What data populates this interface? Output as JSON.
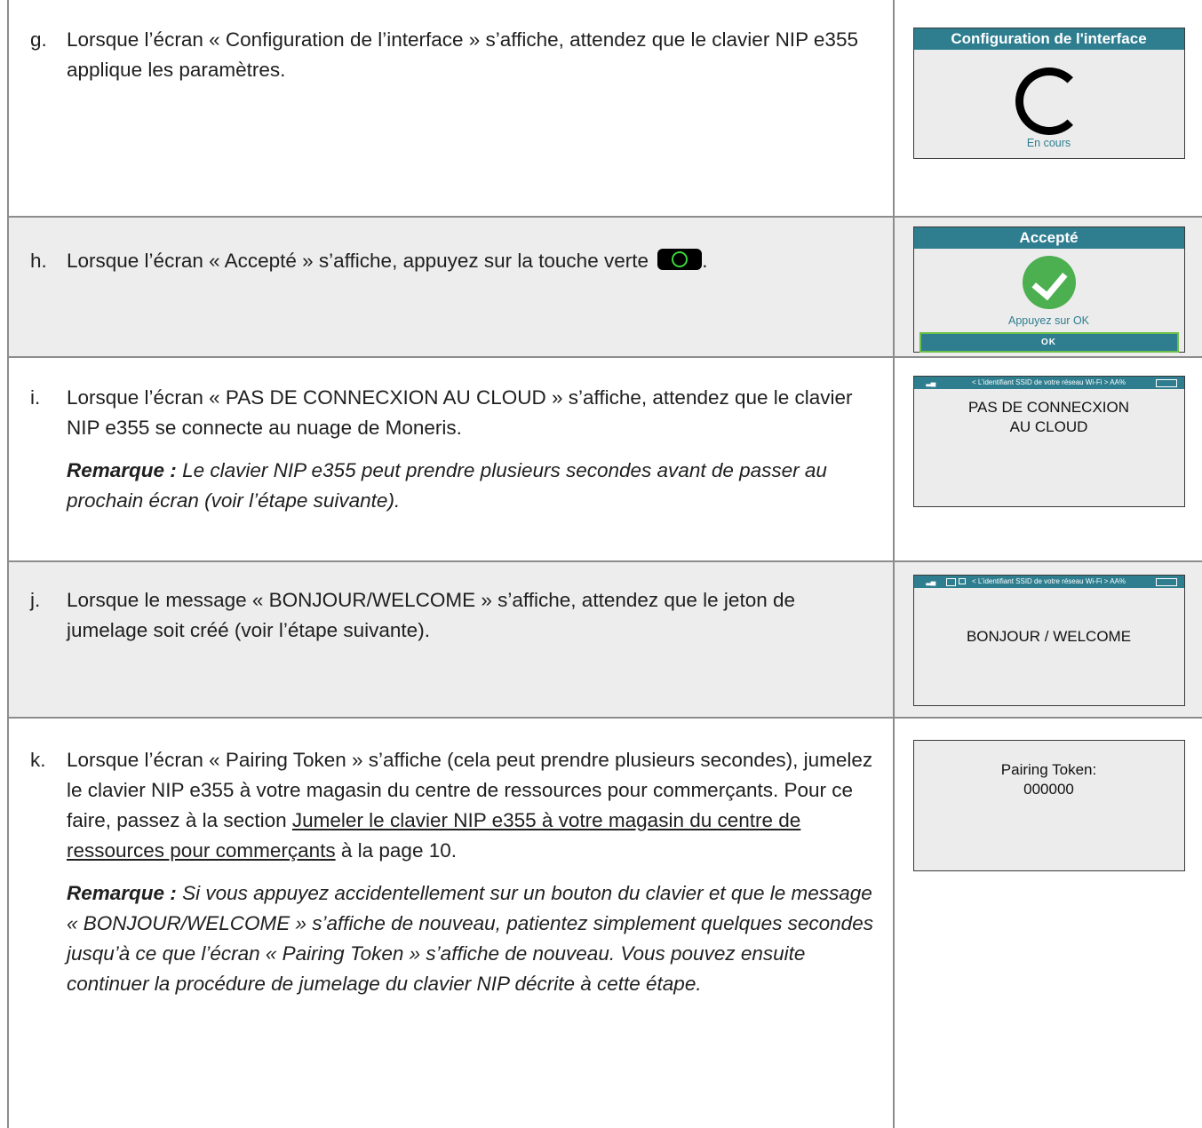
{
  "steps": [
    {
      "letter": "g.",
      "text": "Lorsque l’écran « Configuration de l’interface » s’affiche, attendez que le clavier NIP e355 applique les paramètres.",
      "screen": {
        "header": "Configuration de l'interface",
        "sub": "En cours"
      }
    },
    {
      "letter": "h.",
      "text_before": "Lorsque l’écran « Accepté » s’affiche, appuyez sur la touche verte",
      "text_after": ".",
      "key_icon": "green-ok-key-icon",
      "screen": {
        "header": "Accepté",
        "sub": "Appuyez sur OK",
        "button": "OK"
      }
    },
    {
      "letter": "i.",
      "text": "Lorsque l’écran « PAS DE CONNECXION AU CLOUD » s’affiche, attendez que le clavier NIP e355 se connecte au nuage de Moneris.",
      "note_label": "Remarque :",
      "note_text": "Le clavier NIP e355 peut prendre plusieurs secondes avant de passer au prochain écran (voir l’étape suivante).",
      "screen": {
        "status": "< L’identifiant SSID de votre réseau Wi-Fi > AA%",
        "line1": "PAS DE CONNECXION",
        "line2": "AU CLOUD"
      }
    },
    {
      "letter": "j.",
      "text": "Lorsque le message « BONJOUR/WELCOME » s’affiche, attendez que le jeton de jumelage soit créé (voir l’étape suivante).",
      "screen": {
        "status": "< L’identifiant SSID de votre réseau Wi-Fi > AA%",
        "line1": "BONJOUR / WELCOME"
      }
    },
    {
      "letter": "k.",
      "text_before": "Lorsque l’écran « Pairing Token » s’affiche (cela peut prendre plusieurs secondes), jumelez le clavier NIP e355 à votre magasin du centre de ressources pour commerçants. Pour ce faire, passez à la section",
      "link": "Jumeler le clavier NIP e355 à votre magasin du centre de ressources pour commerçants",
      "text_after": "à la page 10.",
      "note_label": "Remarque :",
      "note_text": "Si vous appuyez accidentellement sur un bouton du clavier et que le message « BONJOUR/WELCOME » s’affiche de nouveau, patientez simplement quelques secondes jusqu’à ce que l’écran « Pairing Token » s’affiche de nouveau. Vous pouvez ensuite continuer la procédure de jumelage du clavier NIP décrite à cette étape.",
      "screen": {
        "line1": "Pairing Token:",
        "line2": "000000"
      }
    }
  ],
  "colors": {
    "screen_header": "#2e7e90",
    "ok_border": "#6cc04a",
    "check": "#4caf50",
    "row_shade": "#ededed"
  }
}
